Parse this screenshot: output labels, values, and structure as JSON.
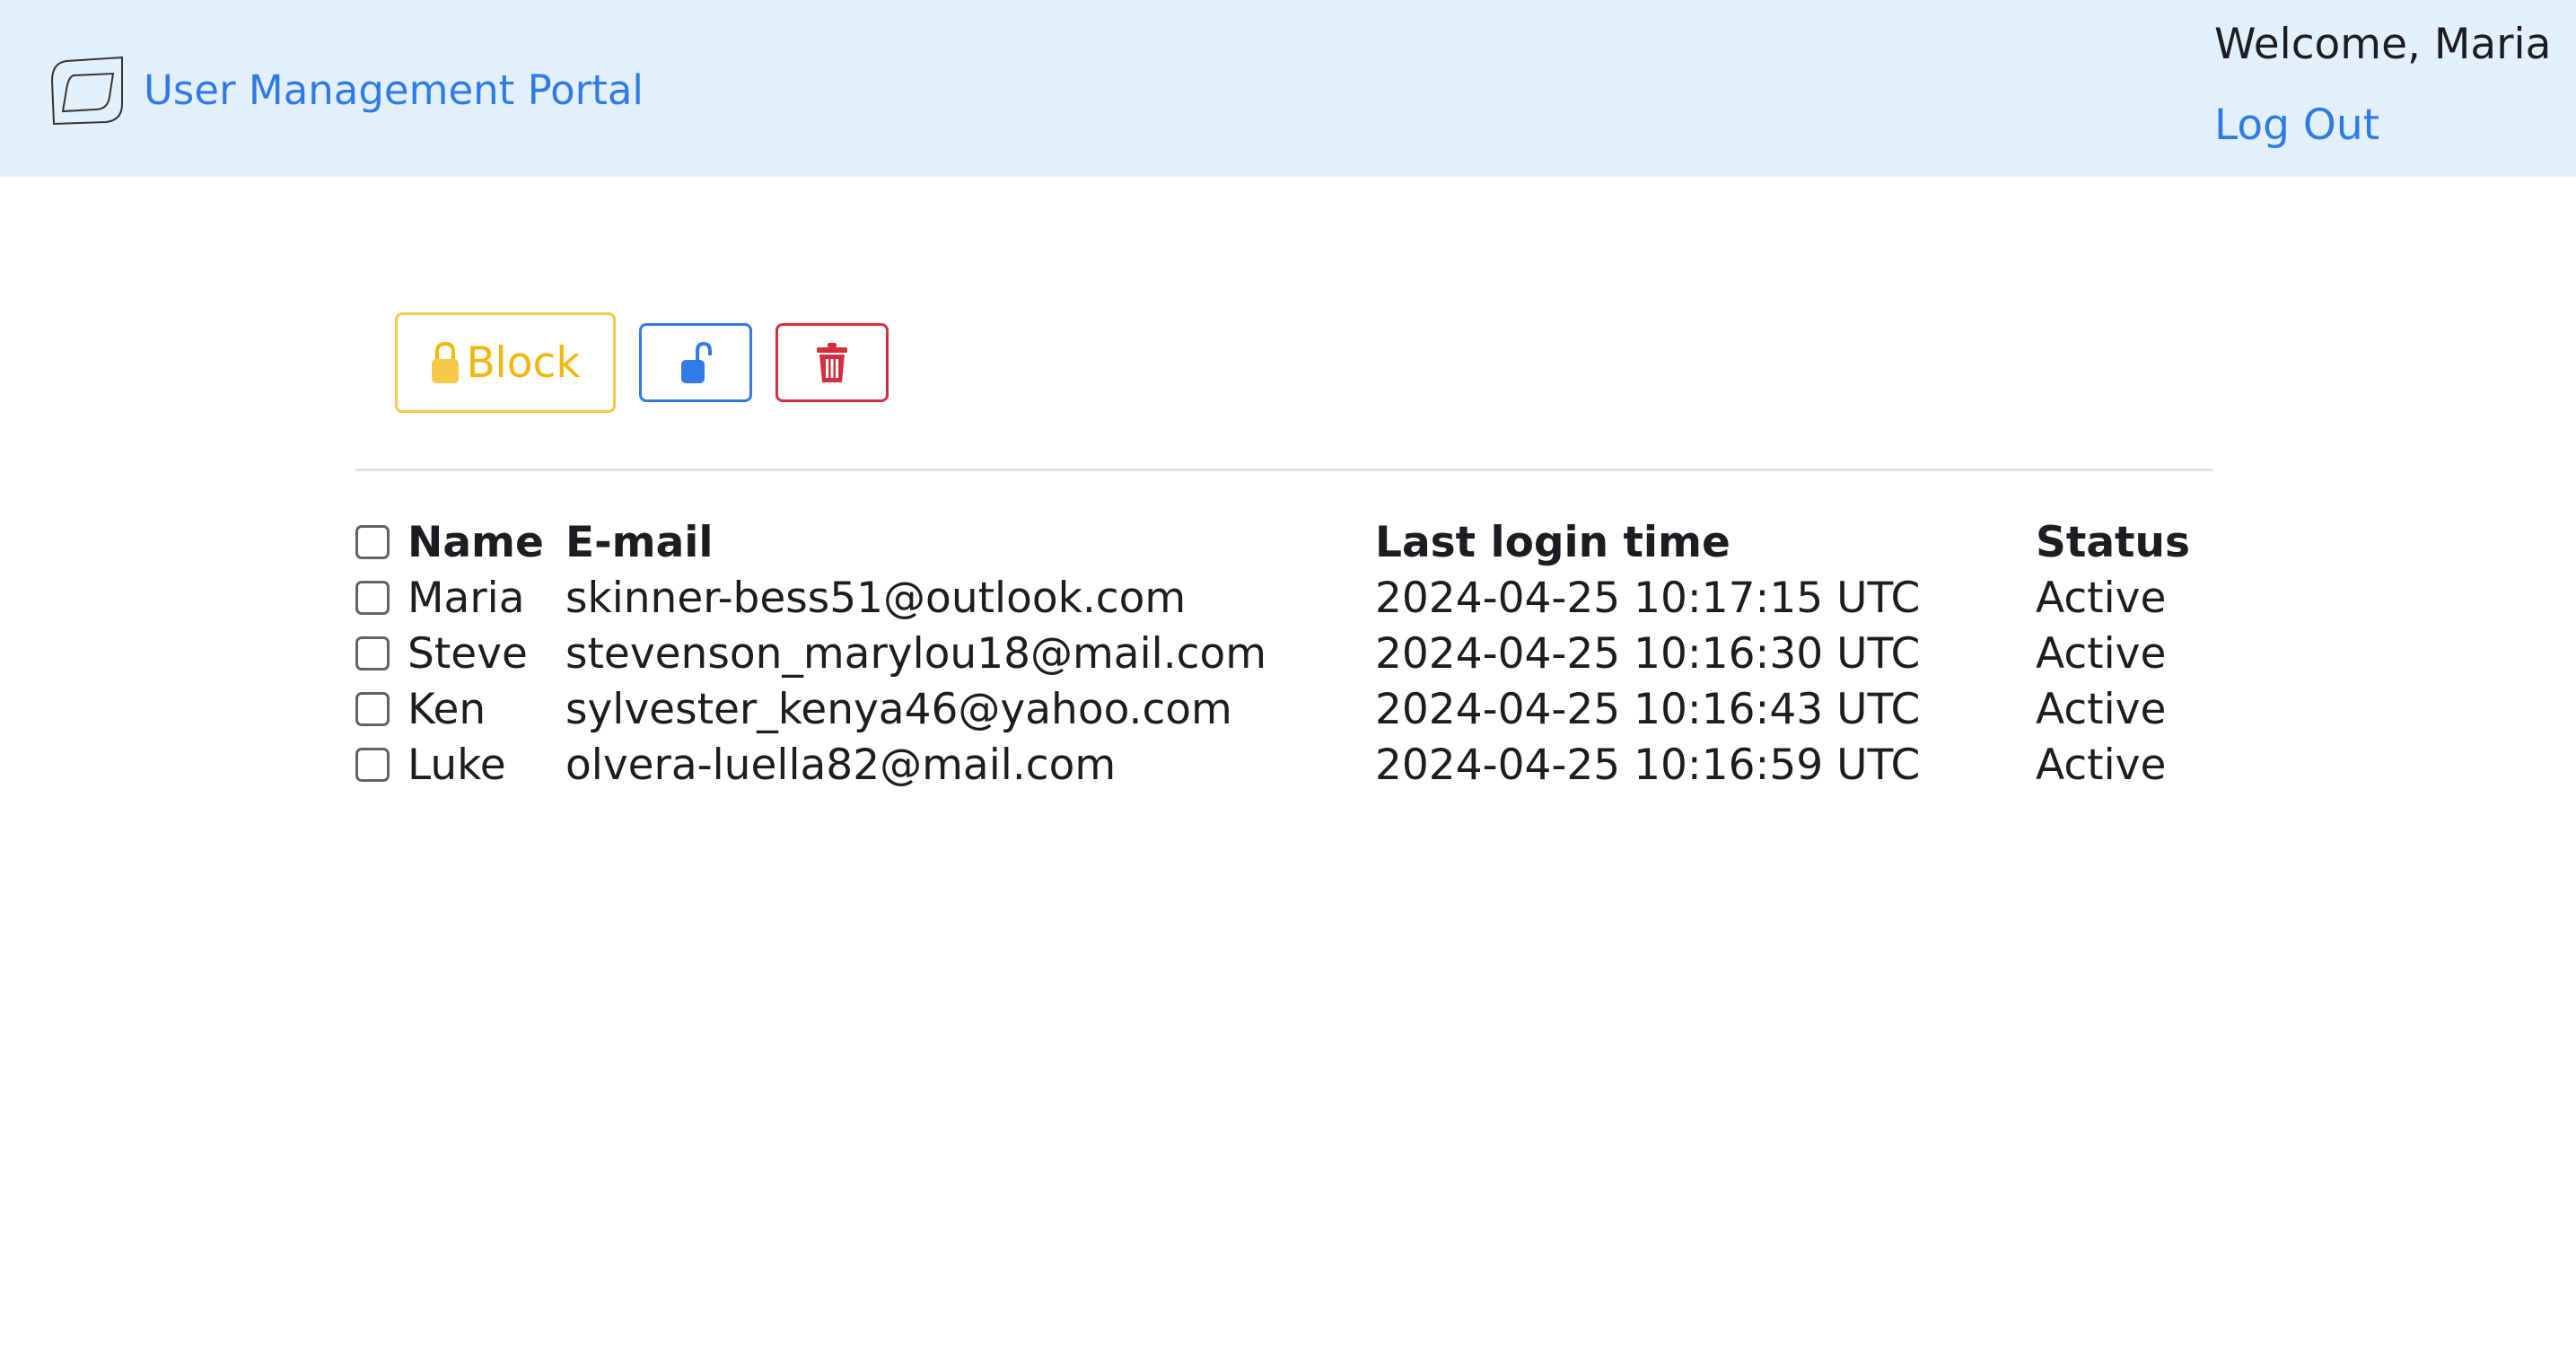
{
  "header": {
    "brand_title": "User Management Portal",
    "welcome_text": "Welcome, Maria",
    "logout_label": "Log Out"
  },
  "toolbar": {
    "block_label": "Block",
    "block_icon": "lock-icon",
    "unblock_icon": "unlock-icon",
    "delete_icon": "trash-icon"
  },
  "table": {
    "headers": {
      "name": "Name",
      "email": "E-mail",
      "last_login": "Last login time",
      "status": "Status"
    },
    "rows": [
      {
        "name": "Maria",
        "email": "skinner-bess51@outlook.com",
        "last_login": "2024-04-25 10:17:15 UTC",
        "status": "Active"
      },
      {
        "name": "Steve",
        "email": "stevenson_marylou18@mail.com",
        "last_login": "2024-04-25 10:16:30 UTC",
        "status": "Active"
      },
      {
        "name": "Ken",
        "email": "sylvester_kenya46@yahoo.com",
        "last_login": "2024-04-25 10:16:43 UTC",
        "status": "Active"
      },
      {
        "name": "Luke",
        "email": "olvera-luella82@mail.com",
        "last_login": "2024-04-25 10:16:59 UTC",
        "status": "Active"
      }
    ]
  },
  "colors": {
    "header_bg": "#e3f0fb",
    "link": "#2f7be6",
    "warning": "#f2b70f",
    "primary": "#3479ea",
    "danger": "#d32f3e"
  }
}
